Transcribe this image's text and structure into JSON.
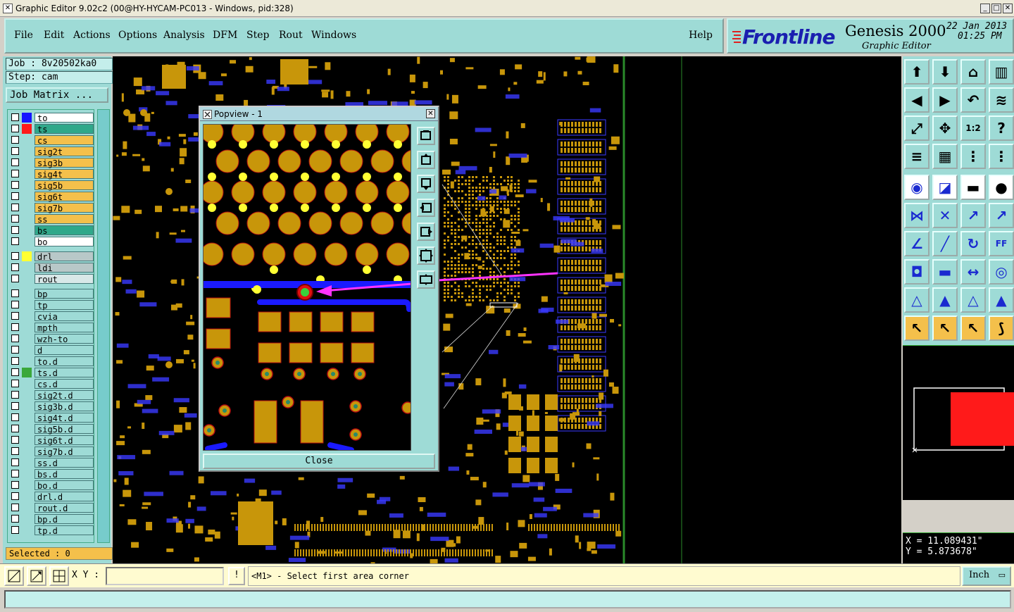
{
  "window": {
    "title": "Graphic Editor 9.02c2 (00@HY-HYCAM-PC013 - Windows, pid:328)",
    "controls": [
      "_",
      "□",
      "✕"
    ]
  },
  "menu": {
    "items": [
      "File",
      "Edit",
      "Actions",
      "Options",
      "Analysis",
      "DFM",
      "Step",
      "Rout",
      "Windows"
    ],
    "help": "Help"
  },
  "brand": {
    "logo": "Frontline",
    "product": "Genesis 2000",
    "subtitle": "Graphic Editor",
    "date": "22 Jan 2013",
    "time": "01:25 PM"
  },
  "job": {
    "job_label": "Job : 8v20502ka0",
    "step_label": "Step: cam",
    "matrix_button": "Job Matrix ..."
  },
  "layers": [
    {
      "name": "to",
      "swatch": "#1515ff",
      "bg": "#ffffff"
    },
    {
      "name": "ts",
      "swatch": "#ff1a1a",
      "bg": "#2fa88a"
    },
    {
      "name": "cs",
      "swatch": "",
      "bg": "#f4c04b"
    },
    {
      "name": "sig2t",
      "swatch": "",
      "bg": "#f4c04b"
    },
    {
      "name": "sig3b",
      "swatch": "",
      "bg": "#f4c04b"
    },
    {
      "name": "sig4t",
      "swatch": "",
      "bg": "#f4c04b"
    },
    {
      "name": "sig5b",
      "swatch": "",
      "bg": "#f4c04b"
    },
    {
      "name": "sig6t",
      "swatch": "",
      "bg": "#f4c04b"
    },
    {
      "name": "sig7b",
      "swatch": "",
      "bg": "#f4c04b"
    },
    {
      "name": "ss",
      "swatch": "",
      "bg": "#f4c04b"
    },
    {
      "name": "bs",
      "swatch": "",
      "bg": "#2fa88a"
    },
    {
      "name": "bo",
      "swatch": "",
      "bg": "#ffffff"
    },
    {
      "name": "drl",
      "swatch": "#ffff33",
      "bg": "#b8c8c8"
    },
    {
      "name": "ldi",
      "swatch": "",
      "bg": "#b8c8c8"
    },
    {
      "name": "rout",
      "swatch": "",
      "bg": "#d8e8e8"
    },
    {
      "name": "bp",
      "swatch": "",
      "bg": "#9edbd6"
    },
    {
      "name": "tp",
      "swatch": "",
      "bg": "#9edbd6"
    },
    {
      "name": "cvia",
      "swatch": "",
      "bg": "#9edbd6"
    },
    {
      "name": "mpth",
      "swatch": "",
      "bg": "#9edbd6"
    },
    {
      "name": "wzh-to",
      "swatch": "",
      "bg": "#9edbd6"
    },
    {
      "name": "d",
      "swatch": "",
      "bg": "#9edbd6"
    },
    {
      "name": "to.d",
      "swatch": "",
      "bg": "#9edbd6"
    },
    {
      "name": "ts.d",
      "swatch": "#3aa83a",
      "bg": "#9edbd6"
    },
    {
      "name": "cs.d",
      "swatch": "",
      "bg": "#9edbd6"
    },
    {
      "name": "sig2t.d",
      "swatch": "",
      "bg": "#9edbd6"
    },
    {
      "name": "sig3b.d",
      "swatch": "",
      "bg": "#9edbd6"
    },
    {
      "name": "sig4t.d",
      "swatch": "",
      "bg": "#9edbd6"
    },
    {
      "name": "sig5b.d",
      "swatch": "",
      "bg": "#9edbd6"
    },
    {
      "name": "sig6t.d",
      "swatch": "",
      "bg": "#9edbd6"
    },
    {
      "name": "sig7b.d",
      "swatch": "",
      "bg": "#9edbd6"
    },
    {
      "name": "ss.d",
      "swatch": "",
      "bg": "#9edbd6"
    },
    {
      "name": "bs.d",
      "swatch": "",
      "bg": "#9edbd6"
    },
    {
      "name": "bo.d",
      "swatch": "",
      "bg": "#9edbd6"
    },
    {
      "name": "drl.d",
      "swatch": "",
      "bg": "#9edbd6"
    },
    {
      "name": "rout.d",
      "swatch": "",
      "bg": "#9edbd6"
    },
    {
      "name": "bp.d",
      "swatch": "",
      "bg": "#9edbd6"
    },
    {
      "name": "tp.d",
      "swatch": "",
      "bg": "#9edbd6"
    }
  ],
  "selected": "Selected : 0",
  "popview": {
    "title": "Popview - 1",
    "close_label": "Close"
  },
  "coords": {
    "x": "X = 11.089431\"",
    "y": "Y = 5.873678\""
  },
  "bottom": {
    "xy_label": "X Y :",
    "xy_value": "",
    "excl": "!",
    "prompt": "<M1> - Select first area corner",
    "units": "Inch"
  },
  "colors": {
    "panel": "#9edbd6",
    "pad": "#c8960a",
    "drill": "#ffff33",
    "trace": "#1a1aff",
    "magenta": "#ff33ff",
    "pcb_text": "#3a3aff"
  }
}
